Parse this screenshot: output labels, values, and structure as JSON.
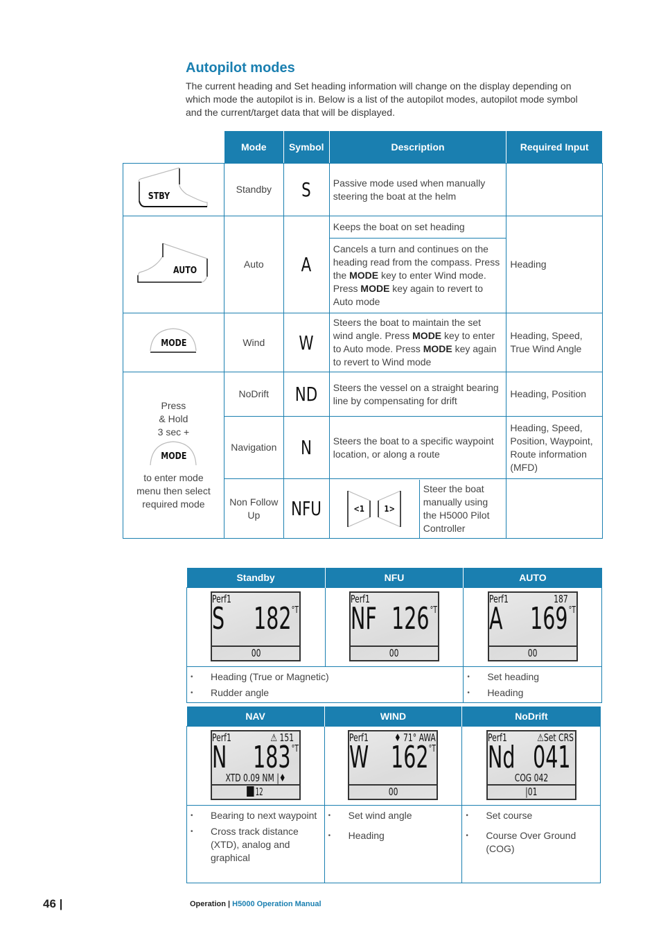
{
  "section": {
    "title": "Autopilot modes",
    "intro": "The current heading and Set heading information will change on the display depending on which mode the autopilot is in. Below is a list of the autopilot modes, autopilot mode symbol and the current/target data that will be displayed."
  },
  "mode_table": {
    "headers": [
      "Mode",
      "Symbol",
      "Description",
      "Required Input"
    ],
    "rows": [
      {
        "key": "STBY",
        "mode": "Standby",
        "symbol": "S",
        "description": "Passive mode used when manually steering the boat at the helm",
        "required_input": ""
      },
      {
        "key": "AUTO",
        "mode": "Auto",
        "symbol": "A",
        "description_1": "Keeps the boat on set heading",
        "description_2_parts": [
          "Cancels a turn and continues on the heading read from the compass. Press the ",
          "MODE",
          " key to enter Wind mode. Press ",
          "MODE",
          " key again to revert to Auto mode"
        ],
        "required_input": "Heading"
      },
      {
        "key": "MODE",
        "mode": "Wind",
        "symbol": "W",
        "description_parts": [
          "Steers the boat to maintain the set wind angle. Press ",
          "MODE",
          " key to enter to Auto mode. Press ",
          "MODE",
          " key again to revert to Wind mode"
        ],
        "required_input": "Heading, Speed, True Wind Angle"
      },
      {
        "mode": "NoDrift",
        "symbol": "ND",
        "description": "Steers the vessel on a straight bearing line by compensating for drift",
        "required_input": "Heading, Position"
      },
      {
        "mode": "Navigation",
        "symbol": "N",
        "description": "Steers the boat to a specific waypoint location, or along a route",
        "required_input": "Heading, Speed, Position, Waypoint, Route information (MFD)"
      },
      {
        "mode": "Non Follow Up",
        "symbol": "NFU",
        "keys": [
          "<1",
          "1>"
        ],
        "description": "Steer the boat manually using the H5000 Pilot Controller",
        "required_input": ""
      }
    ],
    "press_hold": {
      "line1": "Press",
      "line2": "& Hold",
      "line3": "3 sec +",
      "key": "MODE",
      "after": "to enter mode menu then select required mode"
    }
  },
  "display_table_1": {
    "headers": [
      "Standby",
      "NFU",
      "AUTO"
    ],
    "displays": [
      {
        "top_left": "Perf1",
        "top_right": "",
        "mode": "S",
        "value": "182",
        "unit": "°T",
        "sub": "",
        "bottom": "00"
      },
      {
        "top_left": "Perf1",
        "top_right": "",
        "mode": "NF",
        "value": "126",
        "unit": "°T",
        "sub": "",
        "bottom": "00"
      },
      {
        "top_left": "Perf1",
        "top_right": "187",
        "mode": "A",
        "value": "169",
        "unit": "°T",
        "sub": "",
        "bottom": "00"
      }
    ],
    "bullets_left": [
      "Heading (True or Magnetic)",
      "Rudder angle"
    ],
    "bullets_right": [
      "Set heading",
      "Heading"
    ]
  },
  "display_table_2": {
    "headers": [
      "NAV",
      "WIND",
      "NoDrift"
    ],
    "displays": [
      {
        "top_left": "Perf1",
        "top_right": "⚠  151",
        "mode": "N",
        "value": "183",
        "unit": "°T",
        "sub": "XTD 0.09 NM  |♦",
        "bottom": "12"
      },
      {
        "top_left": "Perf1",
        "top_right": "♦ 71°  AWA",
        "mode": "W",
        "value": "162",
        "unit": "°T",
        "sub": "",
        "bottom": "00"
      },
      {
        "top_left": "Perf1",
        "top_right": "⚠Set CRS",
        "mode": "Nd",
        "value": "041",
        "unit": "",
        "sub": "COG  042",
        "bottom": "|01"
      }
    ],
    "bullets": [
      [
        "Bearing to next waypoint",
        "Cross track distance (XTD), analog and graphical"
      ],
      [
        "Set wind angle",
        "Heading"
      ],
      [
        "Set course",
        "Course Over Ground (COG)"
      ]
    ]
  },
  "footer": {
    "page_number": "46 |",
    "section": "Operation | ",
    "manual": "H5000 Operation Manual"
  },
  "colors": {
    "accent": "#1a7fb0"
  }
}
